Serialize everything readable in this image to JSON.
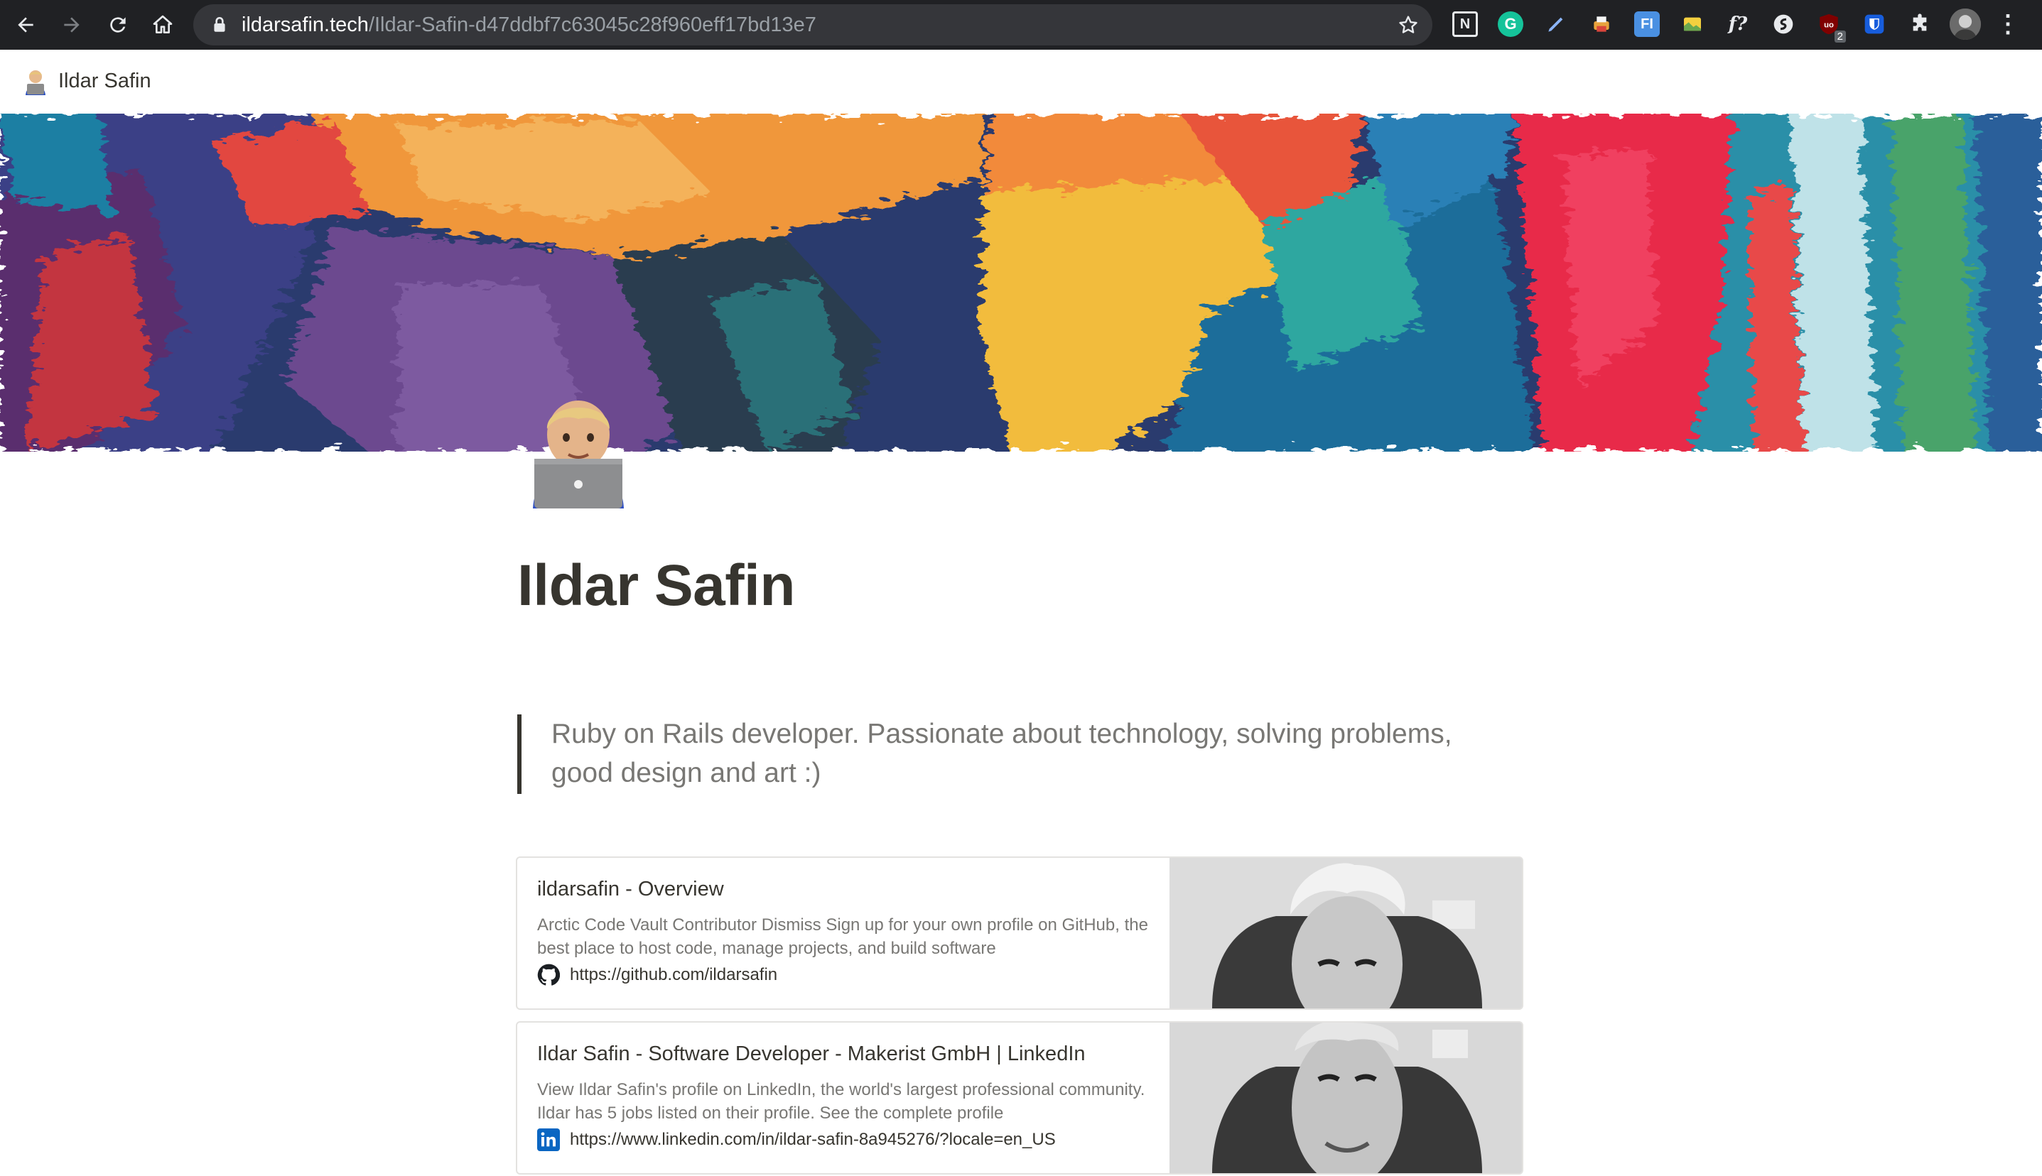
{
  "browser": {
    "url_host": "ildarsafin.tech",
    "url_path": "/Ildar-Safin-d47ddbf7c63045c28f960eff17bd13e7",
    "nav_icons": [
      "back-arrow-icon",
      "forward-arrow-icon",
      "reload-icon",
      "home-icon"
    ],
    "extensions": [
      {
        "name": "notion-extension-icon",
        "label": "N",
        "color": "#ffffff"
      },
      {
        "name": "grammarly-extension-icon",
        "label": "G",
        "color": "#15c39a"
      },
      {
        "name": "pen-extension-icon",
        "label": "",
        "color": "#8ab4f8"
      },
      {
        "name": "printer-extension-icon",
        "label": "",
        "color": "#e8a33d"
      },
      {
        "name": "fi-extension-icon",
        "label": "FI",
        "color": "#4a90e2"
      },
      {
        "name": "note-extension-icon",
        "label": "",
        "color": "#f4d03f"
      },
      {
        "name": "formula-extension-icon",
        "label": "f?",
        "color": "#ffffff"
      },
      {
        "name": "s-extension-icon",
        "label": "",
        "color": "#e8eaed"
      },
      {
        "name": "ublock-extension-icon",
        "label": "uo",
        "badge": "2",
        "color": "#800000"
      },
      {
        "name": "bitwarden-extension-icon",
        "label": "",
        "color": "#175ddc"
      },
      {
        "name": "puzzle-extensions-icon",
        "label": "",
        "color": "#e8eaed"
      },
      {
        "name": "profile-avatar-icon",
        "label": "",
        "color": "#888888"
      },
      {
        "name": "kebab-menu-icon",
        "label": "⋮",
        "color": "#e8eaed"
      }
    ]
  },
  "topbar": {
    "breadcrumb": "Ildar Safin",
    "favicon": "technologist-emoji-icon"
  },
  "page": {
    "icon": "technologist-emoji-icon",
    "title": "Ildar Safin",
    "quote": "Ruby on Rails developer. Passionate about technology, solving problems, good design and art :)"
  },
  "bookmarks": [
    {
      "title": "ildarsafin - Overview",
      "description": "Arctic Code Vault Contributor Dismiss Sign up for your own profile on GitHub, the best place to host code, manage projects, and build software",
      "url": "https://github.com/ildarsafin",
      "icon": "github-icon"
    },
    {
      "title": "Ildar Safin - Software Developer - Makerist GmbH | LinkedIn",
      "description": "View Ildar Safin's profile on LinkedIn, the world's largest professional community. Ildar has 5 jobs listed on their profile. See the complete profile",
      "url": "https://www.linkedin.com/in/ildar-safin-8a945276/?locale=en_US",
      "icon": "linkedin-icon"
    }
  ],
  "colors": {
    "chrome_bg": "#202124",
    "omnibox_bg": "#35363a",
    "text": "#37352f",
    "muted": "#787774",
    "border": "#e3e2e0",
    "linkedin": "#0a66c2"
  }
}
